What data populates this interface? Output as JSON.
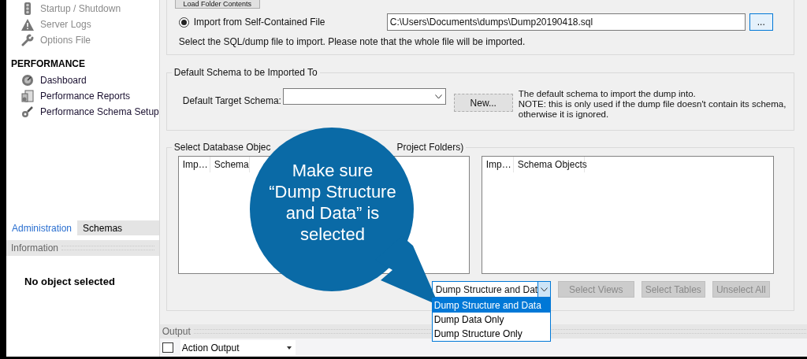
{
  "sidebar": {
    "items_top": [
      {
        "label": "Startup / Shutdown",
        "disabled": true
      },
      {
        "label": "Server Logs",
        "disabled": true
      },
      {
        "label": "Options File",
        "disabled": true
      }
    ],
    "section_title": "PERFORMANCE",
    "items": [
      {
        "label": "Dashboard",
        "disabled": false
      },
      {
        "label": "Performance Reports",
        "disabled": false
      },
      {
        "label": "Performance Schema Setup",
        "disabled": false
      }
    ]
  },
  "tabs": [
    {
      "label": "Administration",
      "selected": true
    },
    {
      "label": "Schemas",
      "selected": false
    }
  ],
  "info_panel": {
    "title": "Information",
    "message": "No object selected"
  },
  "import": {
    "load_button": "Load Folder Contents",
    "radio": {
      "label": "Import from Self-Contained File",
      "selected": true
    },
    "file_path": "C:\\Users\\Documents\\dumps\\Dump20190418.sql",
    "browse_button": "...",
    "hint": "Select the SQL/dump file to import. Please note that the whole file will be imported."
  },
  "default_schema": {
    "group_title": "Default Schema to be Imported To",
    "label": "Default Target Schema:",
    "new_button": "New...",
    "note_lines": [
      "The default schema to import the dump into.",
      "NOTE: this is only used if the dump file doesn't contain its schema,",
      "otherwise it is ignored."
    ]
  },
  "objects": {
    "group_title_parts": [
      "Select Database Objec",
      "Project Folders)"
    ],
    "left_table": {
      "columns": [
        "Imp…",
        "Schema"
      ]
    },
    "right_table": {
      "columns": [
        "Imp…",
        "Schema Objects"
      ]
    },
    "dump_select": {
      "value": "Dump Structure and Dat",
      "options": [
        {
          "label": "Dump Structure and Data",
          "selected": true
        },
        {
          "label": "Dump Data Only",
          "selected": false
        },
        {
          "label": "Dump Structure Only",
          "selected": false
        }
      ]
    },
    "buttons": [
      {
        "label": "Select Views",
        "disabled": true
      },
      {
        "label": "Select Tables",
        "disabled": true
      },
      {
        "label": "Unselect All",
        "disabled": true
      }
    ]
  },
  "output": {
    "title": "Output",
    "select": "Action Output"
  },
  "callout": {
    "lines": [
      "Make sure",
      "“Dump Structure",
      "and Data” is",
      "selected"
    ]
  }
}
